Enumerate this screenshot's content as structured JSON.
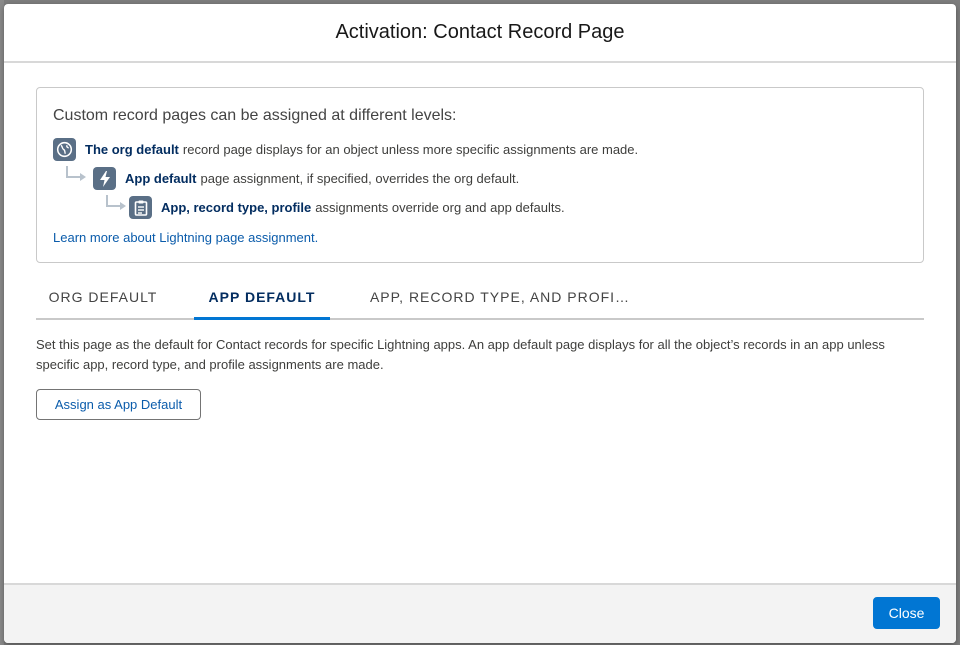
{
  "modal": {
    "title": "Activation: Contact Record Page"
  },
  "info": {
    "heading": "Custom record pages can be assigned at different levels:",
    "levels": [
      {
        "icon": "globe-icon",
        "bold": "The org default",
        "text": "record page displays for an object unless more specific assignments are made."
      },
      {
        "icon": "lightning-icon",
        "bold": "App default",
        "text": "page assignment, if specified, overrides the org default."
      },
      {
        "icon": "clipboard-icon",
        "bold": "App, record type, profile",
        "text": "assignments override org and app defaults."
      }
    ],
    "learn_more": "Learn more about Lightning page assignment."
  },
  "tabs": [
    {
      "label": "ORG DEFAULT",
      "active": false
    },
    {
      "label": "APP DEFAULT",
      "active": true
    },
    {
      "label": "APP, RECORD TYPE, AND PROFI…",
      "active": false
    }
  ],
  "app_default": {
    "description": "Set this page as the default for Contact records for specific Lightning apps. An app default page displays for all the object’s records in an app unless specific app, record type, and profile assignments are made.",
    "assign_button": "Assign as App Default"
  },
  "footer": {
    "close_label": "Close"
  },
  "colors": {
    "brand": "#0176d3",
    "link": "#0b5cab",
    "icon_bg": "#5a6f86",
    "active_tab_text": "#032d60"
  }
}
